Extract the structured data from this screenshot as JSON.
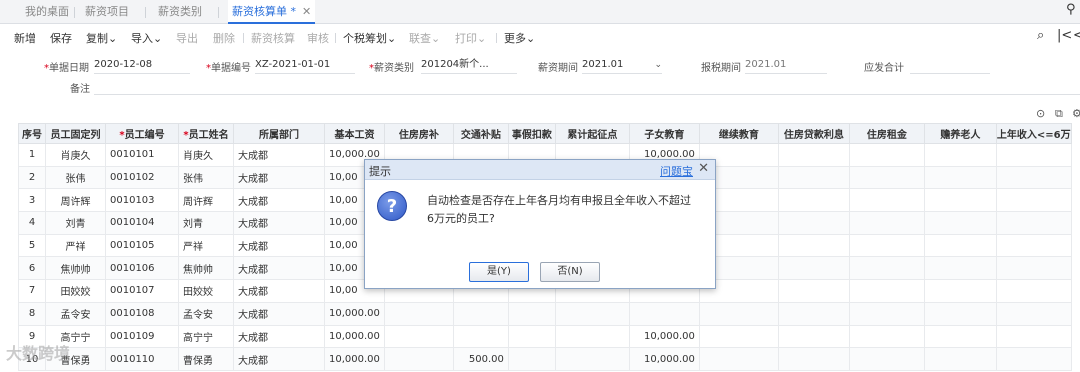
{
  "tabs": [
    {
      "label": "我的桌面"
    },
    {
      "label": "薪资项目"
    },
    {
      "label": "薪资类别"
    },
    {
      "label": "薪资核算单 *",
      "close": "✕"
    }
  ],
  "toolbar": {
    "items": [
      "新增",
      "保存",
      "复制⌄",
      "导入⌄",
      "导出",
      "删除",
      "薪资核算",
      "审核",
      "个税筹划⌄",
      "联查⌄",
      "打印⌄",
      "更多⌄"
    ]
  },
  "form": {
    "date_label": "单据日期",
    "date_value": "2020-12-08",
    "number_label": "单据编号",
    "number_value": "XZ-2021-01-01",
    "category_label": "薪资类别",
    "category_value": "201204新个...",
    "period_label": "薪资期间",
    "period_value": "2021.01",
    "tax_period_label": "报税期间",
    "tax_period_value": "2021.01",
    "total_label": "应发合计",
    "remark_label": "备注"
  },
  "grid": {
    "columns": [
      "序号",
      "员工固定列",
      "员工编号",
      "员工姓名",
      "所属部门",
      "基本工资",
      "住房房补",
      "交通补贴",
      "事假扣款",
      "累计起征点",
      "子女教育",
      "继续教育",
      "住房贷款利息",
      "住房租金",
      "赡养老人",
      "上年收入<=6万"
    ],
    "rows": [
      {
        "seq": "1",
        "fixed": "肖庚久",
        "code": "0010101",
        "name": "肖庚久",
        "dept": "大成都",
        "salary": "10,000.00",
        "traffic": "",
        "child": "10,000.00"
      },
      {
        "seq": "2",
        "fixed": "张伟",
        "code": "0010102",
        "name": "张伟",
        "dept": "大成都",
        "salary": "10,00",
        "traffic": "",
        "child": ""
      },
      {
        "seq": "3",
        "fixed": "周许辉",
        "code": "0010103",
        "name": "周许辉",
        "dept": "大成都",
        "salary": "10,00",
        "traffic": "",
        "child": ""
      },
      {
        "seq": "4",
        "fixed": "刘青",
        "code": "0010104",
        "name": "刘青",
        "dept": "大成都",
        "salary": "10,00",
        "traffic": "",
        "child": ""
      },
      {
        "seq": "5",
        "fixed": "严祥",
        "code": "0010105",
        "name": "严祥",
        "dept": "大成都",
        "salary": "10,00",
        "traffic": "",
        "child": ""
      },
      {
        "seq": "6",
        "fixed": "焦帅帅",
        "code": "0010106",
        "name": "焦帅帅",
        "dept": "大成都",
        "salary": "10,00",
        "traffic": "",
        "child": ""
      },
      {
        "seq": "7",
        "fixed": "田姣姣",
        "code": "0010107",
        "name": "田姣姣",
        "dept": "大成都",
        "salary": "10,00",
        "traffic": "",
        "child": ""
      },
      {
        "seq": "8",
        "fixed": "孟令安",
        "code": "0010108",
        "name": "孟令安",
        "dept": "大成都",
        "salary": "10,000.00",
        "traffic": "",
        "child": ""
      },
      {
        "seq": "9",
        "fixed": "高宁宁",
        "code": "0010109",
        "name": "高宁宁",
        "dept": "大成都",
        "salary": "10,000.00",
        "traffic": "",
        "child": "10,000.00"
      },
      {
        "seq": "10",
        "fixed": "曹保勇",
        "code": "0010110",
        "name": "曹保勇",
        "dept": "大成都",
        "salary": "10,000.00",
        "traffic": "500.00",
        "child": "10,000.00"
      }
    ]
  },
  "dialog": {
    "title": "提示",
    "link": "问题宝",
    "close": "✕",
    "message": "自动检查是否存在上年各月均有申报且全年收入不超过6万元的员工?",
    "yes": "是(Y)",
    "no": "否(N)"
  },
  "watermark": "大数跨境",
  "colors": {
    "accent": "#2a6fdb",
    "required": "#d9001b",
    "dialog_header": "#dde7f5"
  }
}
